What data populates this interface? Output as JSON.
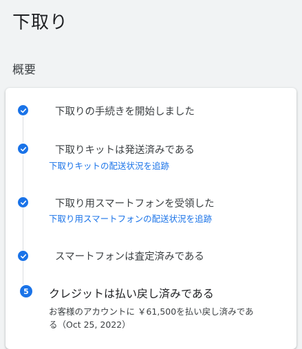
{
  "page": {
    "title": "下取り",
    "section_title": "概要"
  },
  "steps": [
    {
      "label": "下取りの手続きを開始しました",
      "status": "done"
    },
    {
      "label": "下取りキットは発送済みである",
      "link": "下取りキットの配送状況を追跡",
      "status": "done"
    },
    {
      "label": "下取り用スマートフォンを受領した",
      "link": "下取り用スマートフォンの配送状況を追跡",
      "status": "done"
    },
    {
      "label": "スマートフォンは査定済みである",
      "status": "done"
    },
    {
      "number": "5",
      "label": "クレジットは払い戻し済みである",
      "description": "お客様のアカウントに ￥61,500を払い戻し済みである（Oct 25, 2022）",
      "status": "current"
    }
  ],
  "colors": {
    "accent": "#1a73e8",
    "line": "#dadce0"
  }
}
